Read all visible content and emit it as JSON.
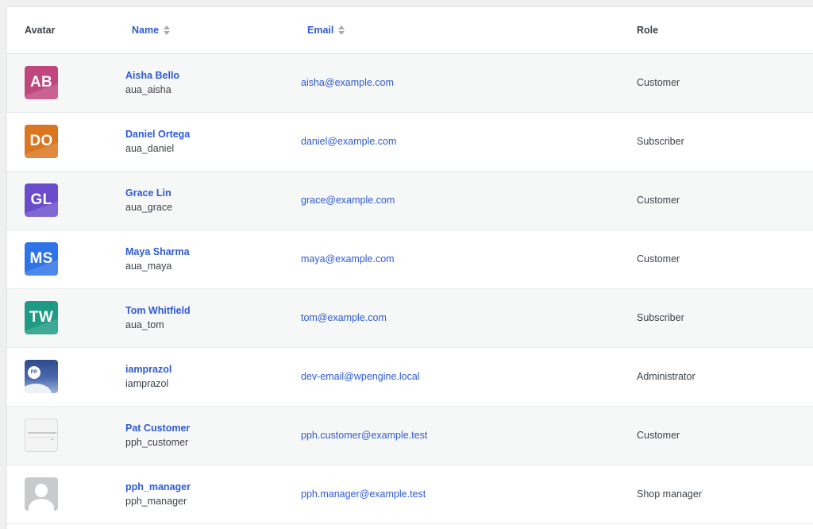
{
  "table": {
    "headers": {
      "avatar": "Avatar",
      "name": "Name",
      "email": "Email",
      "role": "Role"
    },
    "rows": [
      {
        "initials": "AB",
        "avatar_color": "#c0477e",
        "name": "Aisha Bello",
        "login": "aua_aisha",
        "email": "aisha@example.com",
        "role": "Customer"
      },
      {
        "initials": "DO",
        "avatar_color": "#d9761f",
        "name": "Daniel Ortega",
        "login": "aua_daniel",
        "email": "daniel@example.com",
        "role": "Subscriber"
      },
      {
        "initials": "GL",
        "avatar_color": "#6a4ccc",
        "name": "Grace Lin",
        "login": "aua_grace",
        "email": "grace@example.com",
        "role": "Customer"
      },
      {
        "initials": "MS",
        "avatar_color": "#2f73e8",
        "name": "Maya Sharma",
        "login": "aua_maya",
        "email": "maya@example.com",
        "role": "Customer"
      },
      {
        "initials": "TW",
        "avatar_color": "#1f9a84",
        "name": "Tom Whitfield",
        "login": "aua_tom",
        "email": "tom@example.com",
        "role": "Subscriber"
      },
      {
        "avatar_badge": "PP",
        "name": "iamprazol",
        "login": "iamprazol",
        "email": "dev-email@wpengine.local",
        "role": "Administrator"
      },
      {
        "name": "Pat Customer",
        "login": "pph_customer",
        "email": "pph.customer@example.test",
        "role": "Customer"
      },
      {
        "name": "pph_manager",
        "login": "pph_manager",
        "email": "pph.manager@example.test",
        "role": "Shop manager"
      }
    ]
  },
  "colors": {
    "link": "#2e5ad6",
    "row_alt": "#f6f7f7"
  }
}
